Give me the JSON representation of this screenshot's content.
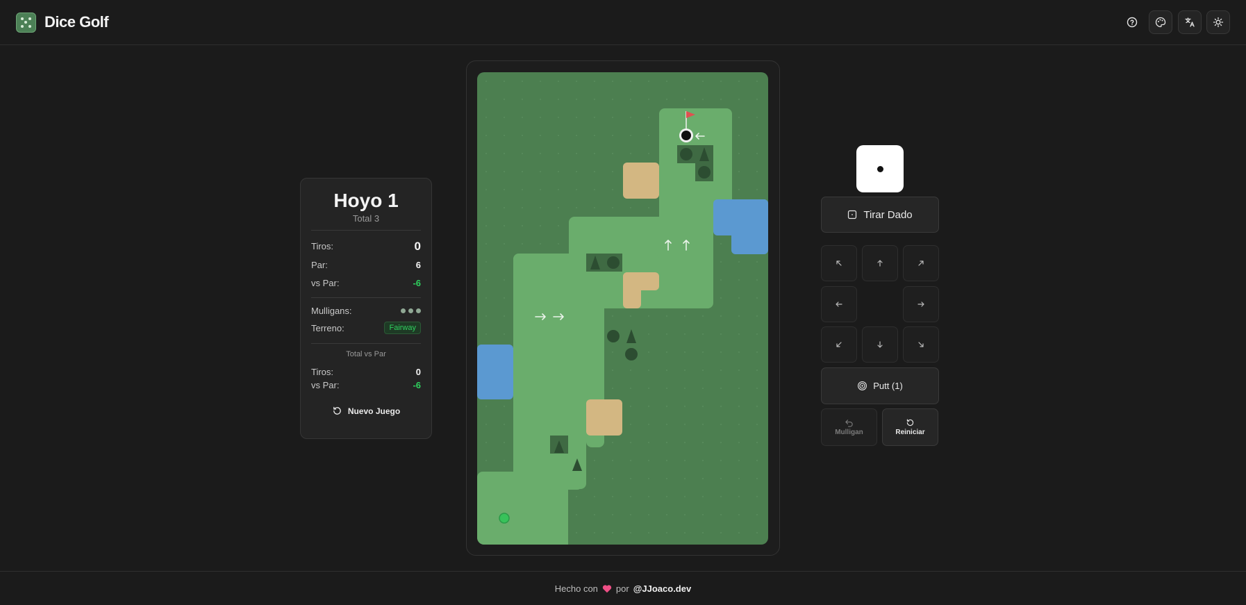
{
  "header": {
    "app_title": "Dice Golf",
    "logo_icon": "dice-icon",
    "icons": [
      "help-icon",
      "palette-icon",
      "translate-icon",
      "sun-icon"
    ]
  },
  "score": {
    "hole_title": "Hoyo 1",
    "hole_subtitle": "Total 3",
    "shots_label": "Tiros:",
    "shots_value": "0",
    "par_label": "Par:",
    "par_value": "6",
    "vs_par_label": "vs Par:",
    "vs_par_value": "-6",
    "mulligans_label": "Mulligans:",
    "mulligans_remaining": 3,
    "terrain_label": "Terreno:",
    "terrain_value": "Fairway",
    "total_title": "Total vs Par",
    "total_shots_label": "Tiros:",
    "total_shots_value": "0",
    "total_vs_par_label": "vs Par:",
    "total_vs_par_value": "-6",
    "new_game_label": "Nuevo Juego"
  },
  "controls": {
    "die_value": 1,
    "roll_label": "Tirar Dado",
    "putt_label": "Putt (1)",
    "mulligan_label": "Mulligan",
    "restart_label": "Reiniciar",
    "directions": [
      "up-left-arrow-icon",
      "up-arrow-icon",
      "up-right-arrow-icon",
      "left-arrow-icon",
      "right-arrow-icon",
      "down-left-arrow-icon",
      "down-arrow-icon",
      "down-right-arrow-icon"
    ]
  },
  "footer": {
    "made_with": "Hecho con",
    "by": "por",
    "author": "@JJoaco.dev"
  },
  "colors": {
    "rough": "#4c7f50",
    "fairway": "#6aad6c",
    "sand": "#d3b782",
    "water": "#5b99d1",
    "tree": "#2c4d31",
    "ball": "#38c25a",
    "accent_green": "#2fd05e"
  }
}
